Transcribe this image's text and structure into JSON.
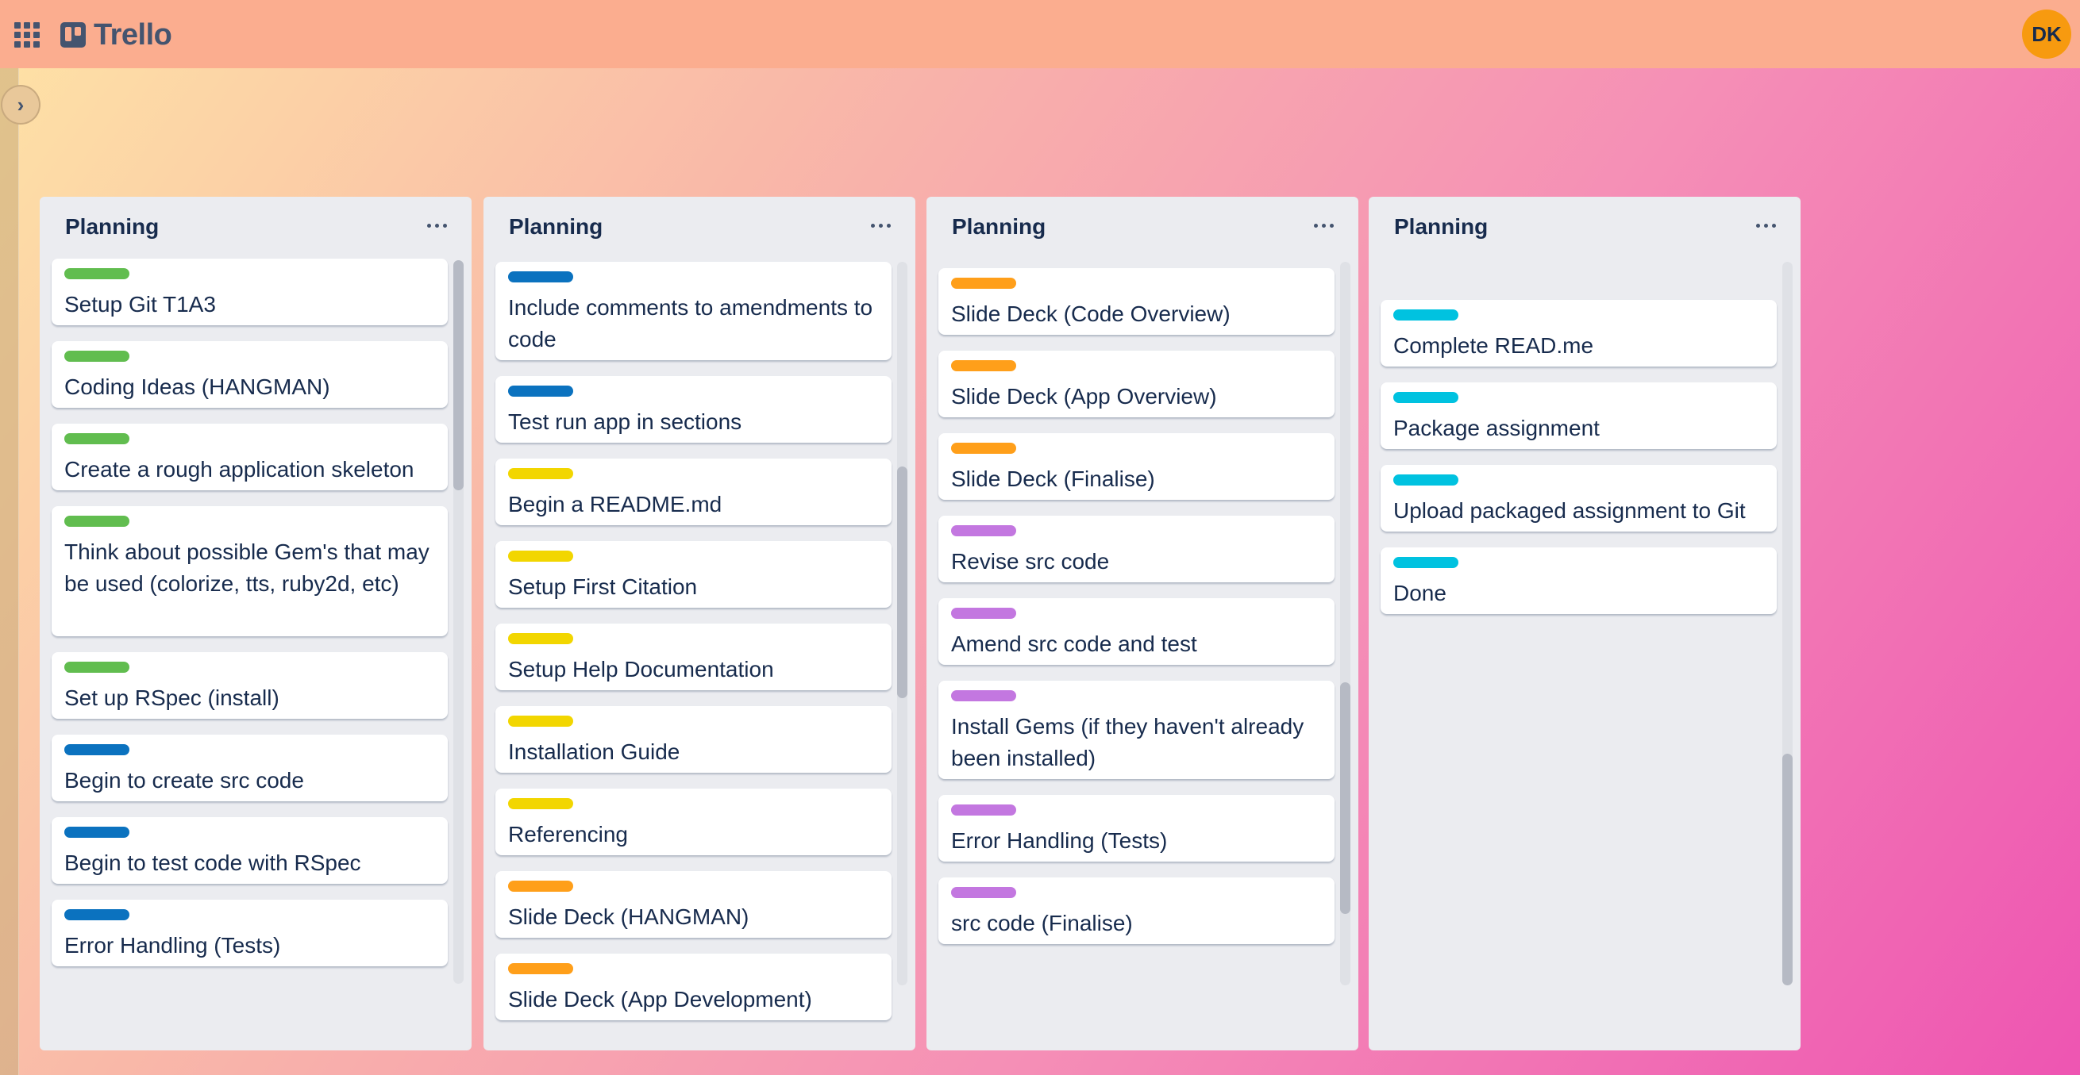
{
  "header": {
    "apps_icon": "grid-apps-icon",
    "logo_text": "Trello",
    "avatar_initials": "DK",
    "avatar_color": "#f79a0f"
  },
  "sidebar": {
    "toggle_icon": "chevron-right-icon",
    "toggle_glyph": "›"
  },
  "label_colors": {
    "green": "#61bd4f",
    "blue": "#0b72bf",
    "yellow": "#f2d600",
    "orange": "#ff9f1a",
    "purple": "#c377e0",
    "sky": "#00c2e0"
  },
  "lists": [
    {
      "title": "Planning",
      "cards": [
        {
          "label": "green",
          "title": "Setup Git T1A3"
        },
        {
          "label": "green",
          "title": "Coding Ideas (HANGMAN)"
        },
        {
          "label": "green",
          "title": "Create a rough application skeleton"
        },
        {
          "label": "green",
          "title": "Think about possible Gem's that may be used (colorize, tts, ruby2d, etc)"
        },
        {
          "label": "green",
          "title": "Set up RSpec (install)"
        },
        {
          "label": "blue",
          "title": "Begin to create src code"
        },
        {
          "label": "blue",
          "title": "Begin to test code with RSpec"
        },
        {
          "label": "blue",
          "title": "Error Handling (Tests)"
        }
      ]
    },
    {
      "title": "Planning",
      "cards": [
        {
          "label": "blue",
          "title": "Include comments to amendments to code"
        },
        {
          "label": "blue",
          "title": "Test run app in sections"
        },
        {
          "label": "yellow",
          "title": "Begin a README.md"
        },
        {
          "label": "yellow",
          "title": "Setup First Citation"
        },
        {
          "label": "yellow",
          "title": "Setup Help Documentation"
        },
        {
          "label": "yellow",
          "title": "Installation Guide"
        },
        {
          "label": "yellow",
          "title": "Referencing"
        },
        {
          "label": "orange",
          "title": "Slide Deck  (HANGMAN)"
        },
        {
          "label": "orange",
          "title": "Slide Deck (App Development)"
        }
      ]
    },
    {
      "title": "Planning",
      "cards": [
        {
          "label": "orange",
          "title": "Slide Deck (Code Overview)"
        },
        {
          "label": "orange",
          "title": "Slide Deck (App Overview)"
        },
        {
          "label": "orange",
          "title": "Slide Deck (Finalise)"
        },
        {
          "label": "purple",
          "title": "Revise src code"
        },
        {
          "label": "purple",
          "title": "Amend src code and test"
        },
        {
          "label": "purple",
          "title": "Install Gems (if they haven't already been installed)"
        },
        {
          "label": "purple",
          "title": "Error Handling (Tests)"
        },
        {
          "label": "purple",
          "title": "src code (Finalise)"
        }
      ]
    },
    {
      "title": "Planning",
      "cards": [
        {
          "label": "sky",
          "title": "Complete READ.me"
        },
        {
          "label": "sky",
          "title": "Package assignment"
        },
        {
          "label": "sky",
          "title": "Upload packaged assignment to Git"
        },
        {
          "label": "sky",
          "title": "Done"
        }
      ]
    }
  ]
}
